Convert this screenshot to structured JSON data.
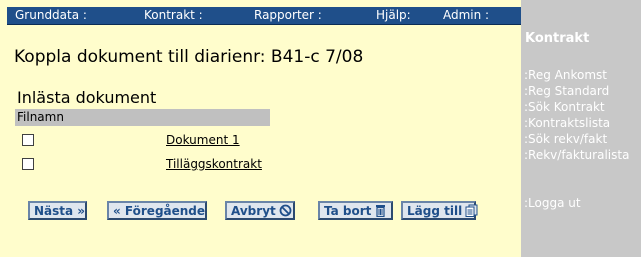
{
  "topnav": {
    "items": [
      "Grunddata :",
      "Kontrakt :",
      "Rapporter :",
      "Hjälp:",
      "Admin :"
    ]
  },
  "page": {
    "title": "Koppla dokument till diarienr: B41-c 7/08"
  },
  "documents": {
    "section_title": "Inlästa dokument",
    "column_header": "Filnamn",
    "rows": [
      {
        "name": "Dokument 1"
      },
      {
        "name": "Tilläggskontrakt"
      }
    ]
  },
  "buttons": {
    "next": "Nästa »",
    "previous": "« Föregående",
    "cancel": "Avbryt",
    "delete": "Ta bort",
    "add": "Lägg till"
  },
  "sidebar": {
    "title": "Kontrakt",
    "links": [
      ":Reg Ankomst",
      ":Reg Standard",
      ":Sök Kontrakt",
      ":Kontraktslista",
      ":Sök rekv/fakt",
      ":Rekv/fakturalista"
    ],
    "logout": ":Logga ut"
  },
  "colors": {
    "background": "#fffdcc",
    "topbar": "#1f4f8a",
    "sidebar": "#c8c8c8",
    "table_header": "#c0c0c0",
    "button_text": "#1f4f8a"
  }
}
